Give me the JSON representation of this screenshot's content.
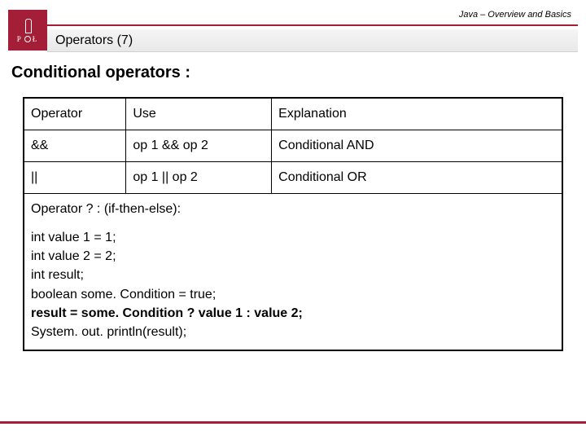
{
  "header": {
    "course": "Java – Overview and Basics",
    "slide_title": "Operators (7)",
    "logo_letter_left": "P",
    "logo_letter_right": "Ł"
  },
  "section_heading": "Conditional operators :",
  "table": {
    "headers": {
      "c1": "Operator",
      "c2": "Use",
      "c3": "Explanation"
    },
    "rows": [
      {
        "c1": "&&",
        "c2": " op 1 && op 2",
        "c3": "Conditional AND"
      },
      {
        "c1": "||",
        "c2": "op 1 || op 2",
        "c3": "Conditional OR"
      }
    ],
    "subheading": "Operator ? : (if-then-else):",
    "code": [
      "int value 1 = 1;",
      "int value 2 = 2;",
      "int result;",
      "boolean some. Condition = true;",
      "result = some. Condition ? value 1 : value 2;",
      "System. out. println(result);"
    ],
    "bold_index": 4
  }
}
